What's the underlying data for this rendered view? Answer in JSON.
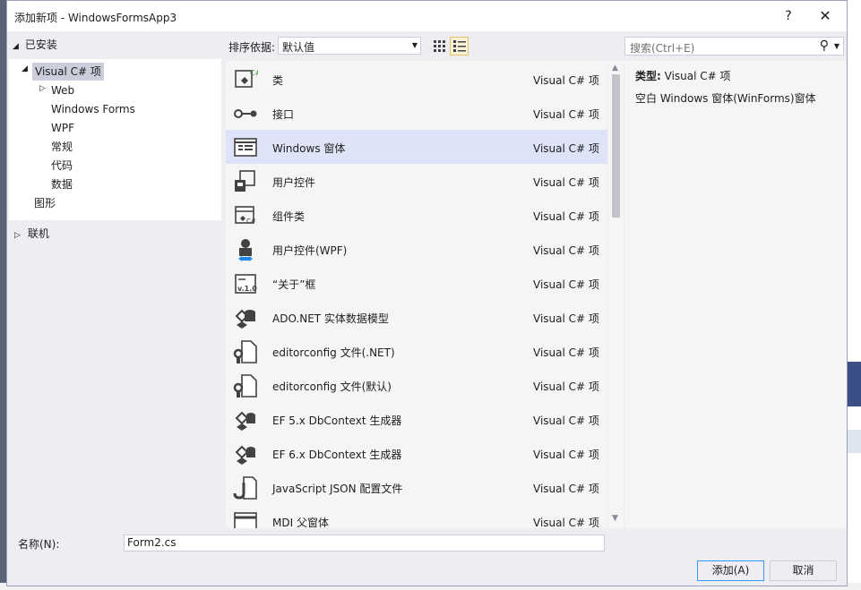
{
  "window": {
    "title": "添加新项 - WindowsFormsApp3",
    "help": "?",
    "close": "✕"
  },
  "left": {
    "installed": "已安装",
    "tree": [
      {
        "label": "Visual C# 项",
        "selected": true
      },
      {
        "label": "Web"
      },
      {
        "label": "Windows Forms"
      },
      {
        "label": "WPF"
      },
      {
        "label": "常规"
      },
      {
        "label": "代码"
      },
      {
        "label": "数据"
      },
      {
        "label": "图形"
      }
    ],
    "online": "联机"
  },
  "toolbar": {
    "sort_label": "排序依据:",
    "sort_value": "默认值",
    "search_placeholder": "搜索(Ctrl+E)"
  },
  "templates": [
    {
      "name": "类",
      "lang": "Visual C# 项",
      "icon": "class-icon"
    },
    {
      "name": "接口",
      "lang": "Visual C# 项",
      "icon": "interface-icon"
    },
    {
      "name": "Windows 窗体",
      "lang": "Visual C# 项",
      "icon": "windows-form-icon",
      "selected": true
    },
    {
      "name": "用户控件",
      "lang": "Visual C# 项",
      "icon": "user-control-icon"
    },
    {
      "name": "组件类",
      "lang": "Visual C# 项",
      "icon": "component-class-icon"
    },
    {
      "name": "用户控件(WPF)",
      "lang": "Visual C# 项",
      "icon": "wpf-user-control-icon"
    },
    {
      "name": "“关于”框",
      "lang": "Visual C# 项",
      "icon": "about-box-icon"
    },
    {
      "name": "ADO.NET 实体数据模型",
      "lang": "Visual C# 项",
      "icon": "entity-model-icon"
    },
    {
      "name": "editorconfig 文件(.NET)",
      "lang": "Visual C# 项",
      "icon": "editorconfig-icon"
    },
    {
      "name": "editorconfig 文件(默认)",
      "lang": "Visual C# 项",
      "icon": "editorconfig-icon"
    },
    {
      "name": "EF 5.x DbContext 生成器",
      "lang": "Visual C# 项",
      "icon": "dbcontext-generator-icon"
    },
    {
      "name": "EF 6.x DbContext 生成器",
      "lang": "Visual C# 项",
      "icon": "dbcontext-generator-icon"
    },
    {
      "name": "JavaScript JSON 配置文件",
      "lang": "Visual C# 项",
      "icon": "json-config-icon"
    },
    {
      "name": "MDI 父窗体",
      "lang": "Visual C# 项",
      "icon": "mdi-parent-form-icon"
    }
  ],
  "info": {
    "type_label": "类型:",
    "type_value": "Visual C# 项",
    "description": "空白 Windows 窗体(WinForms)窗体"
  },
  "bottom": {
    "name_label": "名称(N):",
    "name_value": "Form2.cs",
    "add_label": "添加(A)",
    "cancel_label": "取消"
  },
  "colors": {
    "accent": "#3399ff",
    "selection": "#dfe3f7",
    "dialog_bg": "#eeeef2"
  }
}
